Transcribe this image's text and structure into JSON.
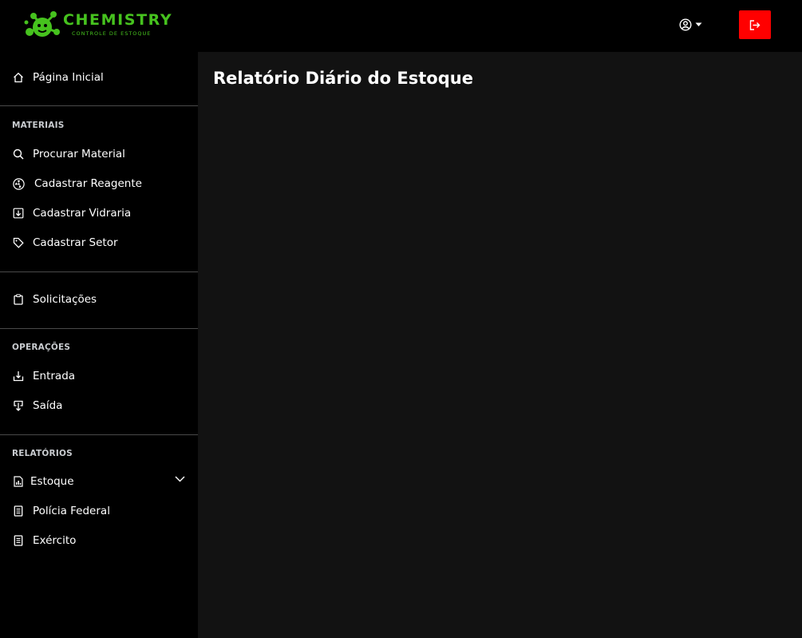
{
  "brand": {
    "name": "CHEMISTRY",
    "subtitle": "CONTROLE DE ESTOQUE",
    "color": "#46c21e"
  },
  "header": {
    "user_icon": "user-circle-icon",
    "logout_icon": "logout-icon",
    "logout_color": "#ff0000"
  },
  "sidebar": {
    "home": {
      "label": "Página Inicial",
      "icon": "home-icon"
    },
    "sections": {
      "materiais": {
        "title": "MATERIAIS",
        "items": [
          {
            "label": "Procurar Material",
            "icon": "search-icon"
          },
          {
            "label": "Cadastrar Reagente",
            "icon": "radiation-icon"
          },
          {
            "label": "Cadastrar Vidraria",
            "icon": "download-box-icon"
          },
          {
            "label": "Cadastrar Setor",
            "icon": "tag-icon"
          }
        ]
      },
      "solicitacoes": {
        "label": "Solicitações",
        "icon": "clipboard-icon"
      },
      "operacoes": {
        "title": "OPERAÇÕES",
        "items": [
          {
            "label": "Entrada",
            "icon": "inbox-in-icon"
          },
          {
            "label": "Saída",
            "icon": "arrow-down-icon"
          }
        ]
      },
      "relatorios": {
        "title": "RELATÓRIOS",
        "items": [
          {
            "label": "Estoque",
            "icon": "bar-chart-file-icon",
            "expandable": true
          },
          {
            "label": "Polícia Federal",
            "icon": "document-icon"
          },
          {
            "label": "Exército",
            "icon": "document-icon"
          }
        ]
      }
    }
  },
  "main": {
    "title": "Relatório Diário do Estoque"
  }
}
